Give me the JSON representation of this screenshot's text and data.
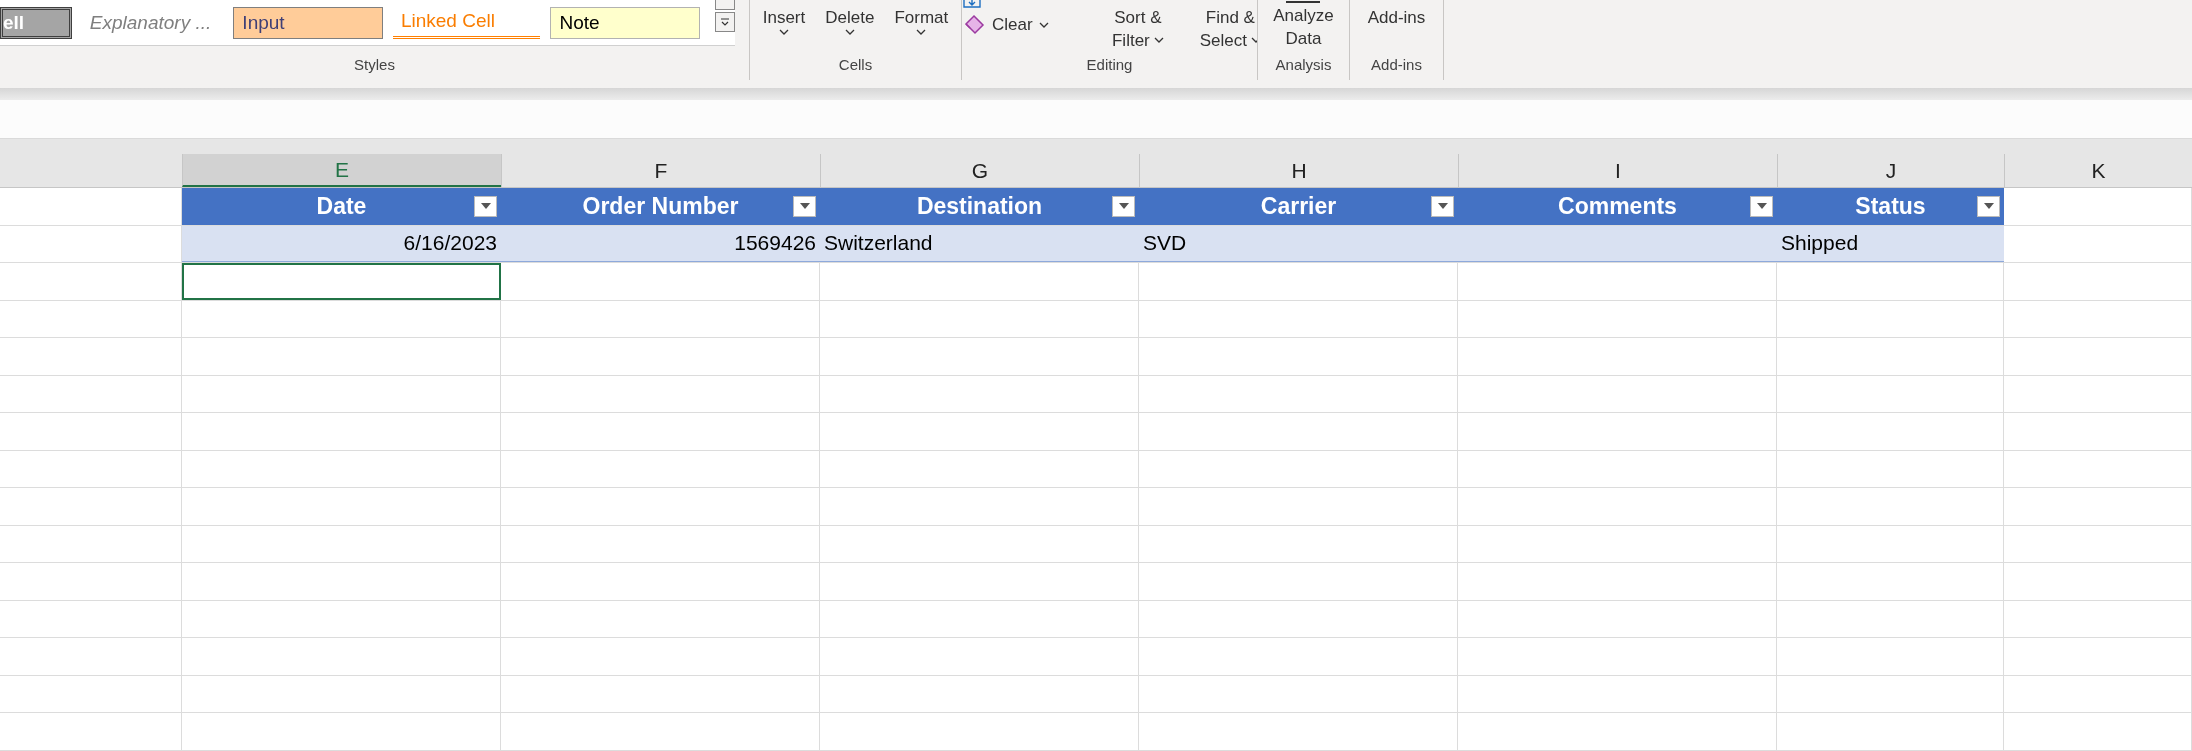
{
  "ribbon": {
    "groups": [
      {
        "kind": "styles",
        "label": "Styles",
        "styles": [
          {
            "label": "ell",
            "kind": "check"
          },
          {
            "label": "Explanatory ...",
            "kind": "explanatory"
          },
          {
            "label": "Input",
            "kind": "input"
          },
          {
            "label": "Linked Cell",
            "kind": "linked"
          },
          {
            "label": "Note",
            "kind": "note"
          }
        ]
      },
      {
        "kind": "cells",
        "label": "Cells",
        "buttons": [
          {
            "lines": [
              "Insert"
            ]
          },
          {
            "lines": [
              "Delete"
            ]
          },
          {
            "lines": [
              "Format"
            ]
          }
        ]
      },
      {
        "kind": "editing",
        "label": "Editing",
        "small": [
          {
            "label": "Clear"
          }
        ],
        "buttons": [
          {
            "lines": [
              "Sort &",
              "Filter"
            ]
          },
          {
            "lines": [
              "Find &",
              "Select"
            ]
          }
        ]
      },
      {
        "kind": "analysis",
        "label": "Analysis",
        "buttons": [
          {
            "lines": [
              "Analyze",
              "Data"
            ]
          }
        ]
      },
      {
        "kind": "addins",
        "label": "Add-ins",
        "buttons": [
          {
            "lines": [
              "Add-ins"
            ]
          }
        ]
      }
    ]
  },
  "sheet": {
    "columns": [
      {
        "label": "E",
        "selected": true
      },
      {
        "label": "F",
        "selected": false
      },
      {
        "label": "G",
        "selected": false
      },
      {
        "label": "H",
        "selected": false
      },
      {
        "label": "I",
        "selected": false
      },
      {
        "label": "J",
        "selected": false
      },
      {
        "label": "K",
        "selected": false
      }
    ],
    "table": {
      "headers": [
        "Date",
        "Order Number",
        "Destination",
        "Carrier",
        "Comments",
        "Status"
      ],
      "rows": [
        {
          "cells": [
            {
              "kind": "number",
              "text": "6/16/2023"
            },
            {
              "kind": "number",
              "text": "1569426"
            },
            {
              "kind": "text",
              "text": "Switzerland"
            },
            {
              "kind": "text",
              "text": "SVD"
            },
            {
              "kind": "empty"
            },
            {
              "kind": "text",
              "text": "Shipped"
            }
          ]
        }
      ]
    }
  }
}
